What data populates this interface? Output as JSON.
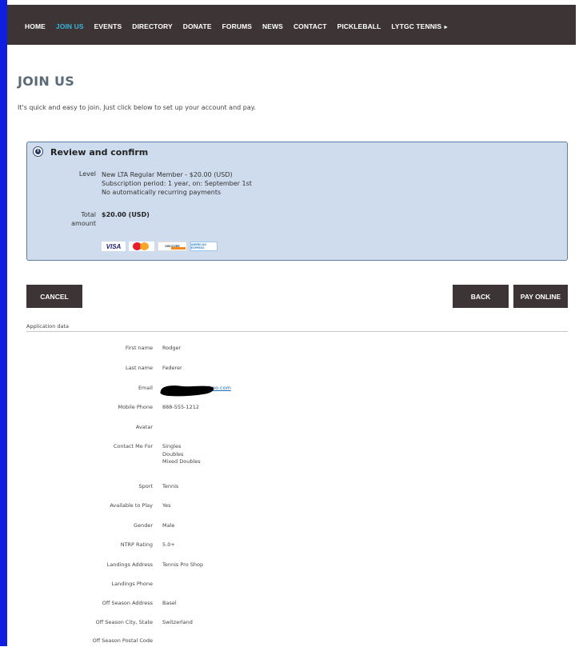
{
  "nav": {
    "items": [
      {
        "label": "HOME"
      },
      {
        "label": "JOIN US",
        "active": true
      },
      {
        "label": "EVENTS"
      },
      {
        "label": "DIRECTORY"
      },
      {
        "label": "DONATE"
      },
      {
        "label": "FORUMS"
      },
      {
        "label": "NEWS"
      },
      {
        "label": "CONTACT"
      },
      {
        "label": "PICKLEBALL"
      },
      {
        "label": "LYTGC TENNIS"
      }
    ],
    "submenu_arrow": "►",
    "colors": {
      "bar": "#3d3535",
      "active": "#3bb4d9",
      "side_accent": "#0f1fe0"
    }
  },
  "page": {
    "title": "JOIN US",
    "intro": "It's quick and easy to join.  Just click below to set up your account and pay."
  },
  "review": {
    "icon": "info-icon",
    "title": "Review and confirm",
    "level_label": "Level",
    "level_lines": [
      "New LTA Regular Member - $20.00 (USD)",
      "Subscription period: 1 year, on: September 1st",
      "No automatically recurring payments"
    ],
    "total_label_1": "Total",
    "total_label_2": "amount",
    "total_value": "$20.00 (USD)",
    "cards": {
      "visa": "VISA",
      "mastercard": "MasterCard",
      "discover": "DISCOVER",
      "amex": "AMERICAN EXPRESS"
    },
    "colors": {
      "background": "#cfdced",
      "border": "#5d7e9e"
    }
  },
  "buttons": {
    "cancel": "CANCEL",
    "back": "BACK",
    "pay_online": "PAY ONLINE"
  },
  "application": {
    "section_label": "Application data",
    "fields": [
      {
        "label": "First name",
        "value": "Rodger"
      },
      {
        "label": "Last name",
        "value": "Federer"
      },
      {
        "label": "Email",
        "value": "ahoo.com",
        "link": true
      },
      {
        "label": "Mobile Phone",
        "value": "888-555-1212"
      },
      {
        "label": "Avatar",
        "value": ""
      },
      {
        "label": "Contact Me For",
        "value": "Singles\nDoubles\nMixed Doubles"
      },
      {
        "label": "Sport",
        "value": "Tennis"
      },
      {
        "label": "Available to Play",
        "value": "Yes"
      },
      {
        "label": "Gender",
        "value": "Male"
      },
      {
        "label": "NTRP Rating",
        "value": "5.0+"
      },
      {
        "label": "Landings Address",
        "value": "Tennis Pro Shop"
      },
      {
        "label": "Landings Phone",
        "value": ""
      },
      {
        "label": "Off Season Address",
        "value": "Basel"
      },
      {
        "label": "Off Season City, State",
        "value": "Switzerland"
      },
      {
        "label": "Off Season Postal Code",
        "value": ""
      }
    ]
  }
}
